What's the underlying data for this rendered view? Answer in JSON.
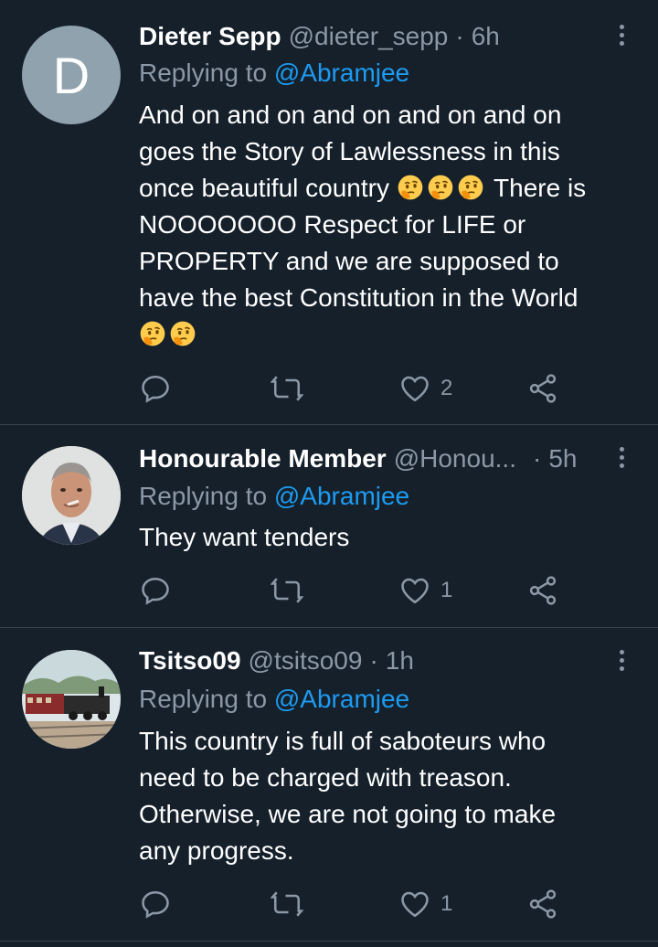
{
  "tweets": [
    {
      "name": "Dieter Sepp",
      "handle": "@dieter_sepp",
      "time": "6h",
      "replying_prefix": "Replying to",
      "replying_to": "@Abramjee",
      "avatar_letter": "D",
      "text_lines": [
        "And on and on and on and on and on",
        "goes the Story of Lawlessness in this",
        "once beautiful country",
        "There is",
        "NOOOOOOO Respect for LIFE or",
        "PROPERTY and we are supposed to",
        "have the best Constitution in the World"
      ],
      "emoji": "thinking-face",
      "like_count": "2"
    },
    {
      "name": "Honourable Member",
      "handle": "@Honou...",
      "time": "5h",
      "replying_prefix": "Replying to",
      "replying_to": "@Abramjee",
      "text": "They want tenders",
      "like_count": "1"
    },
    {
      "name": "Tsitso09",
      "handle": "@tsitso09",
      "time": "1h",
      "replying_prefix": "Replying to",
      "replying_to": "@Abramjee",
      "text_lines": [
        "This country is full of saboteurs who",
        "need to be charged with treason.",
        "Otherwise, we are not going to make",
        "any progress."
      ],
      "like_count": "1"
    }
  ],
  "icons": {
    "reply": "reply-bubble-icon",
    "retweet": "retweet-icon",
    "like": "heart-icon",
    "share": "share-icon",
    "more": "more-vertical-icon"
  },
  "colors": {
    "background": "#15202b",
    "muted": "#8b98a5",
    "link": "#1d9bf0",
    "divider": "#38444d"
  }
}
